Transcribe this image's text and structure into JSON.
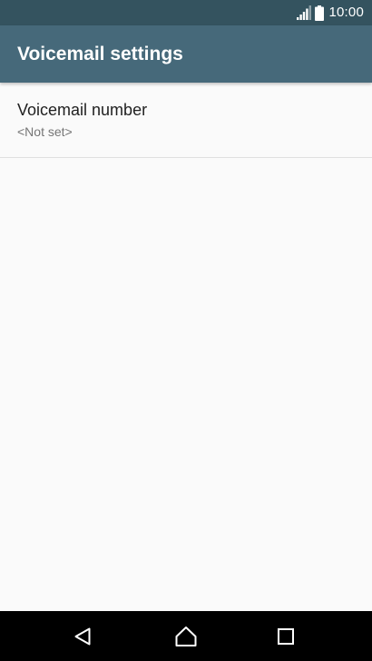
{
  "status_bar": {
    "time": "10:00",
    "icons": [
      "signal-icon",
      "battery-icon"
    ]
  },
  "app_bar": {
    "title": "Voicemail settings"
  },
  "settings": {
    "items": [
      {
        "title": "Voicemail number",
        "summary": "<Not set>"
      }
    ]
  },
  "nav_bar": {
    "icons": [
      "back-icon",
      "home-icon",
      "recent-apps-icon"
    ]
  },
  "colors": {
    "status_bar": "#34535f",
    "app_bar": "#46697a",
    "background": "#fafafa",
    "nav_bar": "#000000"
  }
}
